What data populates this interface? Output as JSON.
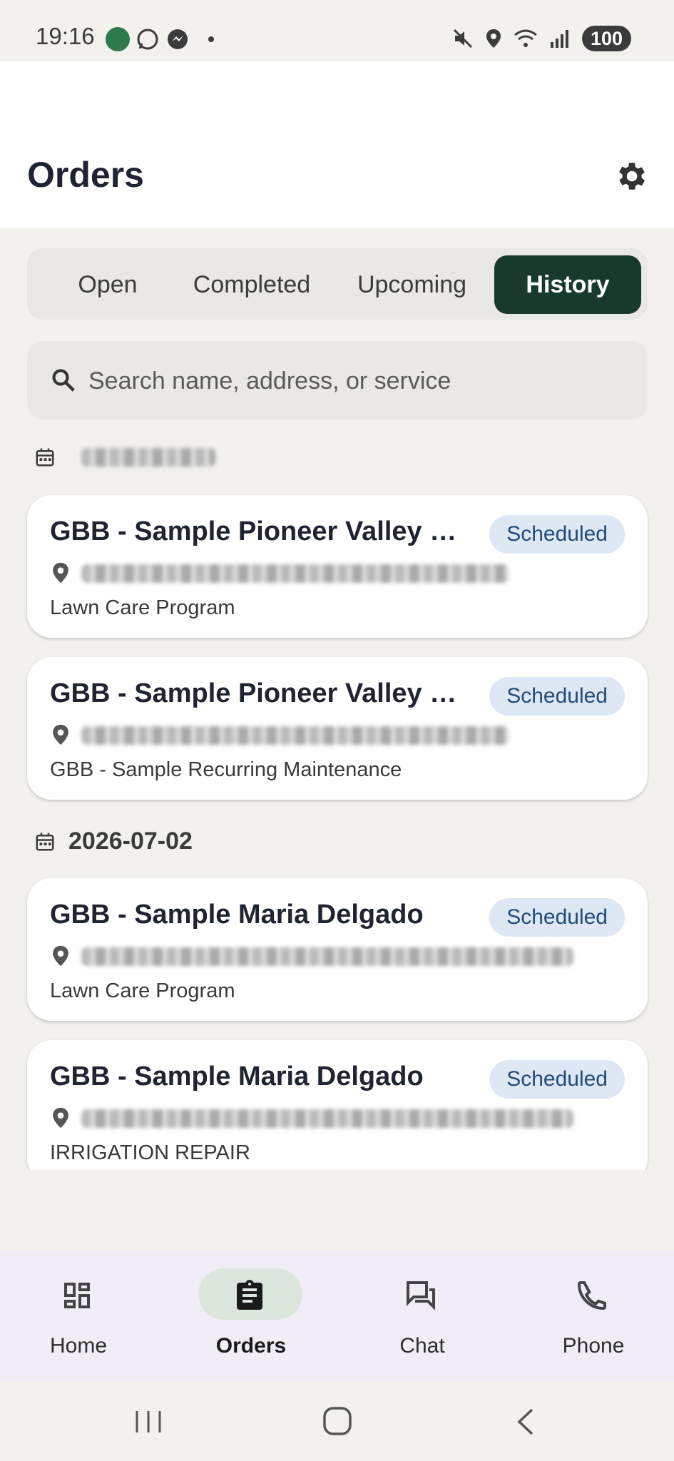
{
  "status_bar": {
    "time": "19:16",
    "battery": "100",
    "app_icons": [
      "leaf-app-icon",
      "whatsapp-icon",
      "messenger-icon"
    ]
  },
  "header": {
    "title": "Orders"
  },
  "tabs": [
    {
      "label": "Open",
      "active": false
    },
    {
      "label": "Completed",
      "active": false
    },
    {
      "label": "Upcoming",
      "active": false
    },
    {
      "label": "History",
      "active": true
    }
  ],
  "search": {
    "placeholder": "Search name, address, or service"
  },
  "groups": [
    {
      "date": "",
      "orders": [
        {
          "title": "GBB - Sample Pioneer Valley D...",
          "status": "Scheduled",
          "service": "Lawn Care Program"
        },
        {
          "title": "GBB - Sample Pioneer Valley D...",
          "status": "Scheduled",
          "service": "GBB - Sample Recurring Maintenance"
        }
      ]
    },
    {
      "date": "2026-07-02",
      "orders": [
        {
          "title": "GBB - Sample Maria Delgado",
          "status": "Scheduled",
          "service": "Lawn Care Program"
        },
        {
          "title": "GBB - Sample Maria Delgado",
          "status": "Scheduled",
          "service": "IRRIGATION REPAIR"
        }
      ]
    }
  ],
  "bottom_nav": [
    {
      "label": "Home",
      "icon": "dashboard-icon",
      "active": false
    },
    {
      "label": "Orders",
      "icon": "clipboard-icon",
      "active": true
    },
    {
      "label": "Chat",
      "icon": "chat-icon",
      "active": false
    },
    {
      "label": "Phone",
      "icon": "phone-icon",
      "active": false
    }
  ],
  "colors": {
    "accent": "#173a2d",
    "badge_bg": "#dde8f4",
    "badge_text": "#234a78",
    "nav_bg": "#f1edf6"
  }
}
